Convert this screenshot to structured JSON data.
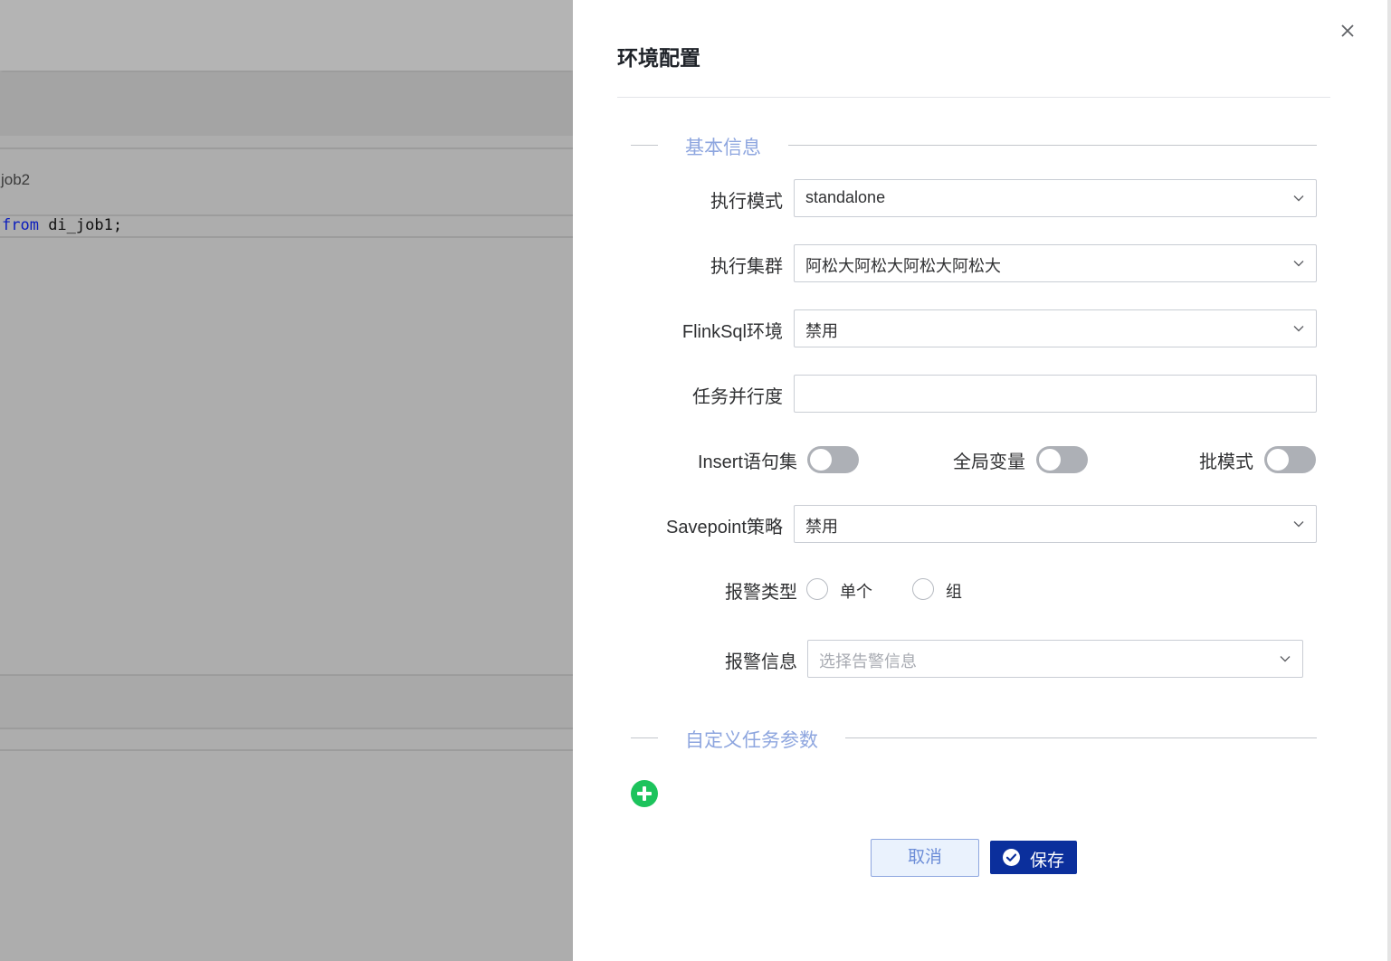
{
  "background": {
    "tab_label": "job2",
    "code_keyword": "from",
    "code_rest": " di_job1;"
  },
  "drawer": {
    "title": "环境配置",
    "close_icon": "close-icon",
    "sections": {
      "basic": "基本信息",
      "custom": "自定义任务参数"
    },
    "fields": {
      "exec_mode": {
        "label": "执行模式",
        "value": "standalone"
      },
      "exec_cluster": {
        "label": "执行集群",
        "value": "阿松大阿松大阿松大阿松大"
      },
      "flinksql_env": {
        "label": "FlinkSql环境",
        "value": "禁用"
      },
      "parallelism": {
        "label": "任务并行度",
        "value": ""
      },
      "insert_set": {
        "label": "Insert语句集",
        "on": false
      },
      "global_vars": {
        "label": "全局变量",
        "on": false
      },
      "batch_mode": {
        "label": "批模式",
        "on": false
      },
      "savepoint": {
        "label": "Savepoint策略",
        "value": "禁用"
      },
      "alert_type": {
        "label": "报警类型",
        "options": [
          "单个",
          "组"
        ],
        "selected": null
      },
      "alert_info": {
        "label": "报警信息",
        "placeholder": "选择告警信息"
      }
    },
    "buttons": {
      "cancel": "取消",
      "save": "保存"
    },
    "colors": {
      "primary": "#0b2f9c",
      "section_text": "#8ea6df",
      "add": "#1cc35c",
      "switch_off": "#adb0b6"
    }
  }
}
